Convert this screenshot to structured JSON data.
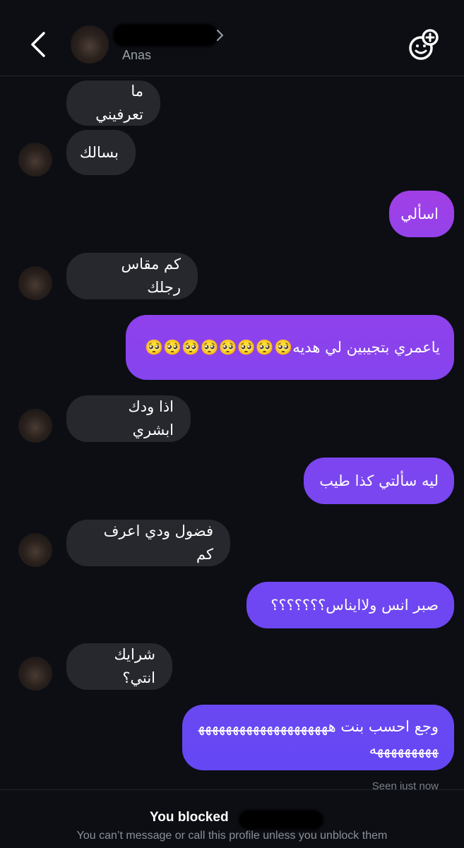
{
  "header": {
    "contact_name": "Anas",
    "back_icon": "chevron-left-icon",
    "effects_icon": "face-plus-icon"
  },
  "messages": [
    {
      "direction": "incoming",
      "text": "ما تعرفيني"
    },
    {
      "direction": "incoming",
      "text": "بسالك"
    },
    {
      "direction": "outgoing",
      "text": "اسألي"
    },
    {
      "direction": "incoming",
      "text": "كم مقاس رجلك"
    },
    {
      "direction": "outgoing",
      "text": "ياعمري بتجيبين لي هديه🥺🥺🥺🥺🥺🥺🥺🥺"
    },
    {
      "direction": "incoming",
      "text": "اذا ودك ابشري"
    },
    {
      "direction": "outgoing",
      "text": "ليه سألتي كذا طيب"
    },
    {
      "direction": "incoming",
      "text": "فضول ودي اعرف كم"
    },
    {
      "direction": "outgoing",
      "text": "صبر انس ولاايناس؟؟؟؟؟؟؟"
    },
    {
      "direction": "incoming",
      "text": "شرايك انتي؟"
    },
    {
      "direction": "outgoing",
      "text": "وجع احسب بنت هههههههههههههههههههههههههههههه"
    }
  ],
  "seen_text": "Seen just now",
  "footer": {
    "title": "You blocked",
    "subtitle": "You can’t message or call this profile unless you unblock them"
  },
  "colors": {
    "background": "#0c0e13",
    "incoming_bubble": "#26282e",
    "outgoing_gradient_top": "#9f3fe6",
    "outgoing_gradient_bottom": "#6c46f2"
  }
}
